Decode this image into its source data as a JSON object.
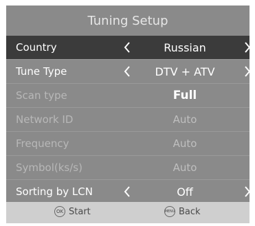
{
  "title": "Tuning Setup",
  "rows": [
    {
      "label": "Country",
      "value": "Russian"
    },
    {
      "label": "Tune Type",
      "value": "DTV + ATV"
    },
    {
      "label": "Scan type",
      "value": "Full"
    },
    {
      "label": "Network ID",
      "value": "Auto"
    },
    {
      "label": "Frequency",
      "value": "Auto"
    },
    {
      "label": "Symbol(ks/s)",
      "value": "Auto"
    },
    {
      "label": "Sorting by LCN",
      "value": "Off"
    }
  ],
  "footer": {
    "start_badge": "OK",
    "start_label": "Start",
    "back_badge": "MENU",
    "back_label": "Back"
  },
  "colors": {
    "panel": "#8a8a8a",
    "selected_row": "#3b3b3b",
    "footer": "#cfcfcf"
  },
  "icons": [
    "chevron-left-icon",
    "chevron-right-icon",
    "ok-button-icon",
    "menu-button-icon"
  ]
}
